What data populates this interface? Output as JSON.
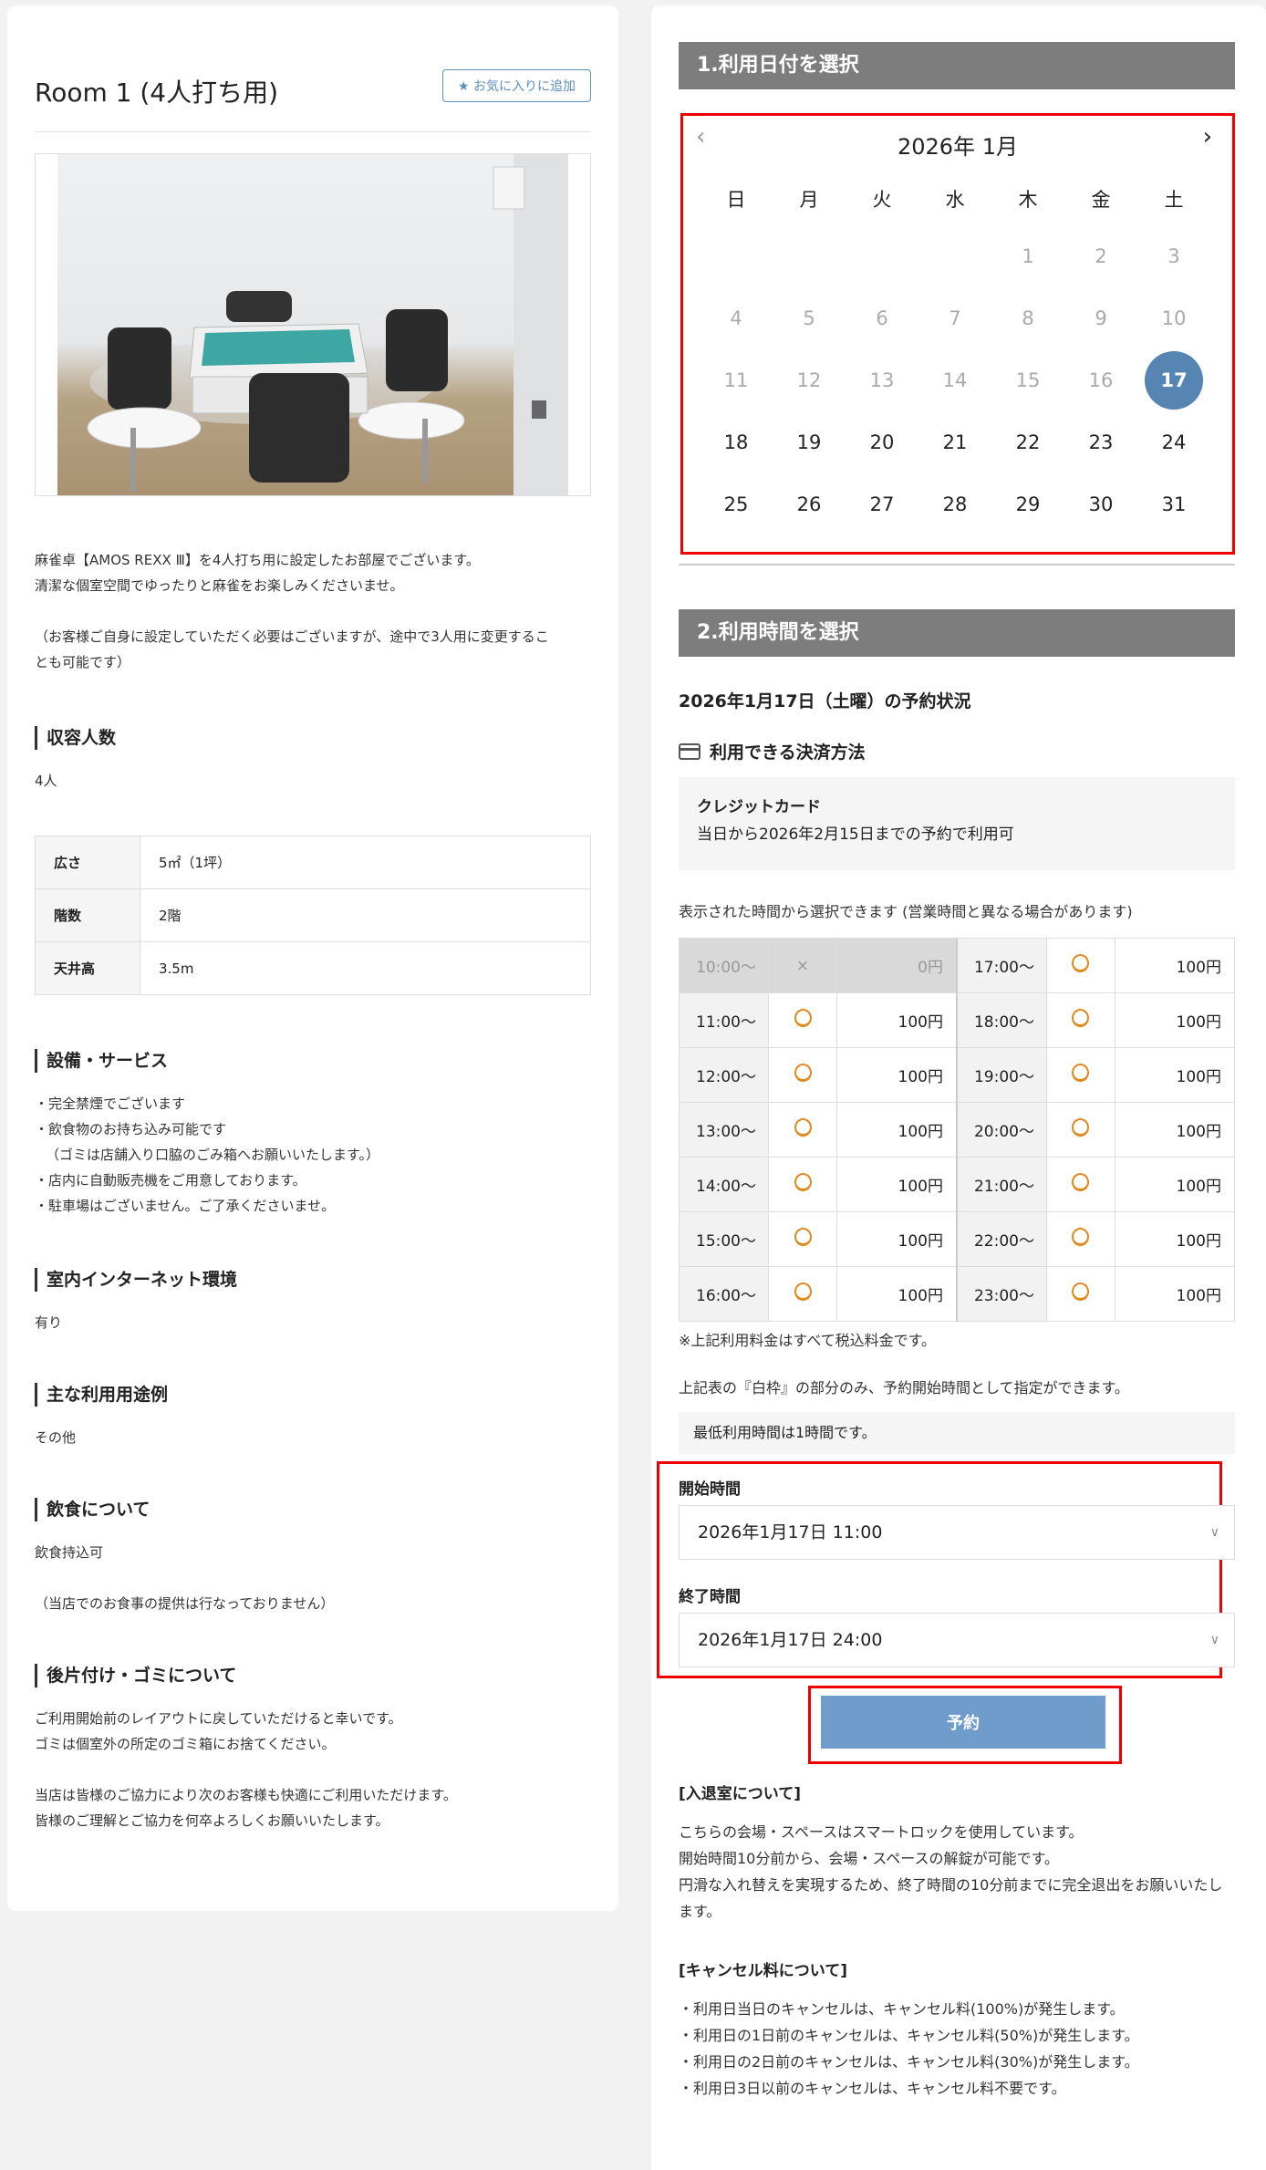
{
  "room": {
    "title": "Room 1 (4人打ち用)",
    "favorite_label": "★ お気に入りに追加",
    "description": [
      "麻雀卓【AMOS REXX Ⅲ】を4人打ち用に設定したお部屋でございます。",
      "清潔な個室空間でゆったりと麻雀をお楽しみくださいませ。",
      "（お客様ご自身に設定していただく必要はございますが、途中で3人用に変更するこ",
      "とも可能です）"
    ]
  },
  "capacity": {
    "heading": "収容人数",
    "value": "4人"
  },
  "specs": [
    {
      "key": "広さ",
      "value": "5㎡（1坪）"
    },
    {
      "key": "階数",
      "value": "2階"
    },
    {
      "key": "天井高",
      "value": "3.5m"
    }
  ],
  "facilities": {
    "heading": "設備・サービス",
    "lines": [
      "・完全禁煙でございます",
      "・飲食物のお持ち込み可能です",
      "（ゴミは店舗入り口脇のごみ箱へお願いいたします。）",
      "・店内に自動販売機をご用意しております。",
      "・駐車場はございません。ご了承くださいませ。"
    ]
  },
  "internet": {
    "heading": "室内インターネット環境",
    "value": "有り"
  },
  "usage": {
    "heading": "主な利用用途例",
    "value": "その他"
  },
  "food": {
    "heading": "飲食について",
    "value": "飲食持込可",
    "note": "（当店でのお食事の提供は行なっておりません）"
  },
  "cleanup": {
    "heading": "後片付け・ゴミについて",
    "lines": [
      "ご利用開始前のレイアウトに戻していただけると幸いです。",
      "ゴミは個室外の所定のゴミ箱にお捨てください。",
      "当店は皆様のご協力により次のお客様も快適にご利用いただけます。",
      "皆様のご理解とご協力を何卒よろしくお願いいたします。"
    ]
  },
  "step1": {
    "label": "1.利用日付を選択"
  },
  "calendar": {
    "month_label": "2026年 1月",
    "prev": "‹",
    "next": "›",
    "weekdays": [
      "日",
      "月",
      "火",
      "水",
      "木",
      "金",
      "土"
    ],
    "weeks": [
      [
        "",
        "",
        "",
        "",
        "1",
        "2",
        "3"
      ],
      [
        "4",
        "5",
        "6",
        "7",
        "8",
        "9",
        "10"
      ],
      [
        "11",
        "12",
        "13",
        "14",
        "15",
        "16",
        "17"
      ],
      [
        "18",
        "19",
        "20",
        "21",
        "22",
        "23",
        "24"
      ],
      [
        "25",
        "26",
        "27",
        "28",
        "29",
        "30",
        "31"
      ]
    ],
    "selected": "17",
    "first_enabled": 17
  },
  "step2": {
    "label": "2.利用時間を選択"
  },
  "reservation_status": "2026年1月17日（土曜）の予約状況",
  "payment": {
    "heading": "利用できる決済方法",
    "method": "クレジットカード",
    "detail": "当日から2026年2月15日までの予約で利用可"
  },
  "time_note": "表示された時間から選択できます (営業時間と異なる場合があります)",
  "slots_left": [
    {
      "time": "10:00〜",
      "mark": "×",
      "price": "0円",
      "available": false
    },
    {
      "time": "11:00〜",
      "mark": "○",
      "price": "100円",
      "available": true
    },
    {
      "time": "12:00〜",
      "mark": "○",
      "price": "100円",
      "available": true
    },
    {
      "time": "13:00〜",
      "mark": "○",
      "price": "100円",
      "available": true
    },
    {
      "time": "14:00〜",
      "mark": "○",
      "price": "100円",
      "available": true
    },
    {
      "time": "15:00〜",
      "mark": "○",
      "price": "100円",
      "available": true
    },
    {
      "time": "16:00〜",
      "mark": "○",
      "price": "100円",
      "available": true
    }
  ],
  "slots_right": [
    {
      "time": "17:00〜",
      "mark": "○",
      "price": "100円",
      "available": true
    },
    {
      "time": "18:00〜",
      "mark": "○",
      "price": "100円",
      "available": true
    },
    {
      "time": "19:00〜",
      "mark": "○",
      "price": "100円",
      "available": true
    },
    {
      "time": "20:00〜",
      "mark": "○",
      "price": "100円",
      "available": true
    },
    {
      "time": "21:00〜",
      "mark": "○",
      "price": "100円",
      "available": true
    },
    {
      "time": "22:00〜",
      "mark": "○",
      "price": "100円",
      "available": true
    },
    {
      "time": "23:00〜",
      "mark": "○",
      "price": "100円",
      "available": true
    }
  ],
  "tax_note": "※上記利用料金はすべて税込料金です。",
  "white_note": "上記表の『白枠』の部分のみ、予約開始時間として指定ができます。",
  "min_time": "最低利用時間は1時間です。",
  "start": {
    "label": "開始時間",
    "value": "2026年1月17日 11:00"
  },
  "end": {
    "label": "終了時間",
    "value": "2026年1月17日 24:00"
  },
  "reserve_label": "予約",
  "entry": {
    "heading": "[入退室について]",
    "lines": [
      "こちらの会場・スペースはスマートロックを使用しています。",
      "開始時間10分前から、会場・スペースの解錠が可能です。",
      "円滑な入れ替えを実現するため、終了時間の10分前までに完全退出をお願いいたし",
      "ます。"
    ]
  },
  "cancel": {
    "heading": "[キャンセル料について]",
    "lines": [
      "・利用日当日のキャンセルは、キャンセル料(100%)が発生します。",
      "・利用日の1日前のキャンセルは、キャンセル料(50%)が発生します。",
      "・利用日の2日前のキャンセルは、キャンセル料(30%)が発生します。",
      "・利用日3日以前のキャンセルは、キャンセル料不要です。"
    ]
  }
}
